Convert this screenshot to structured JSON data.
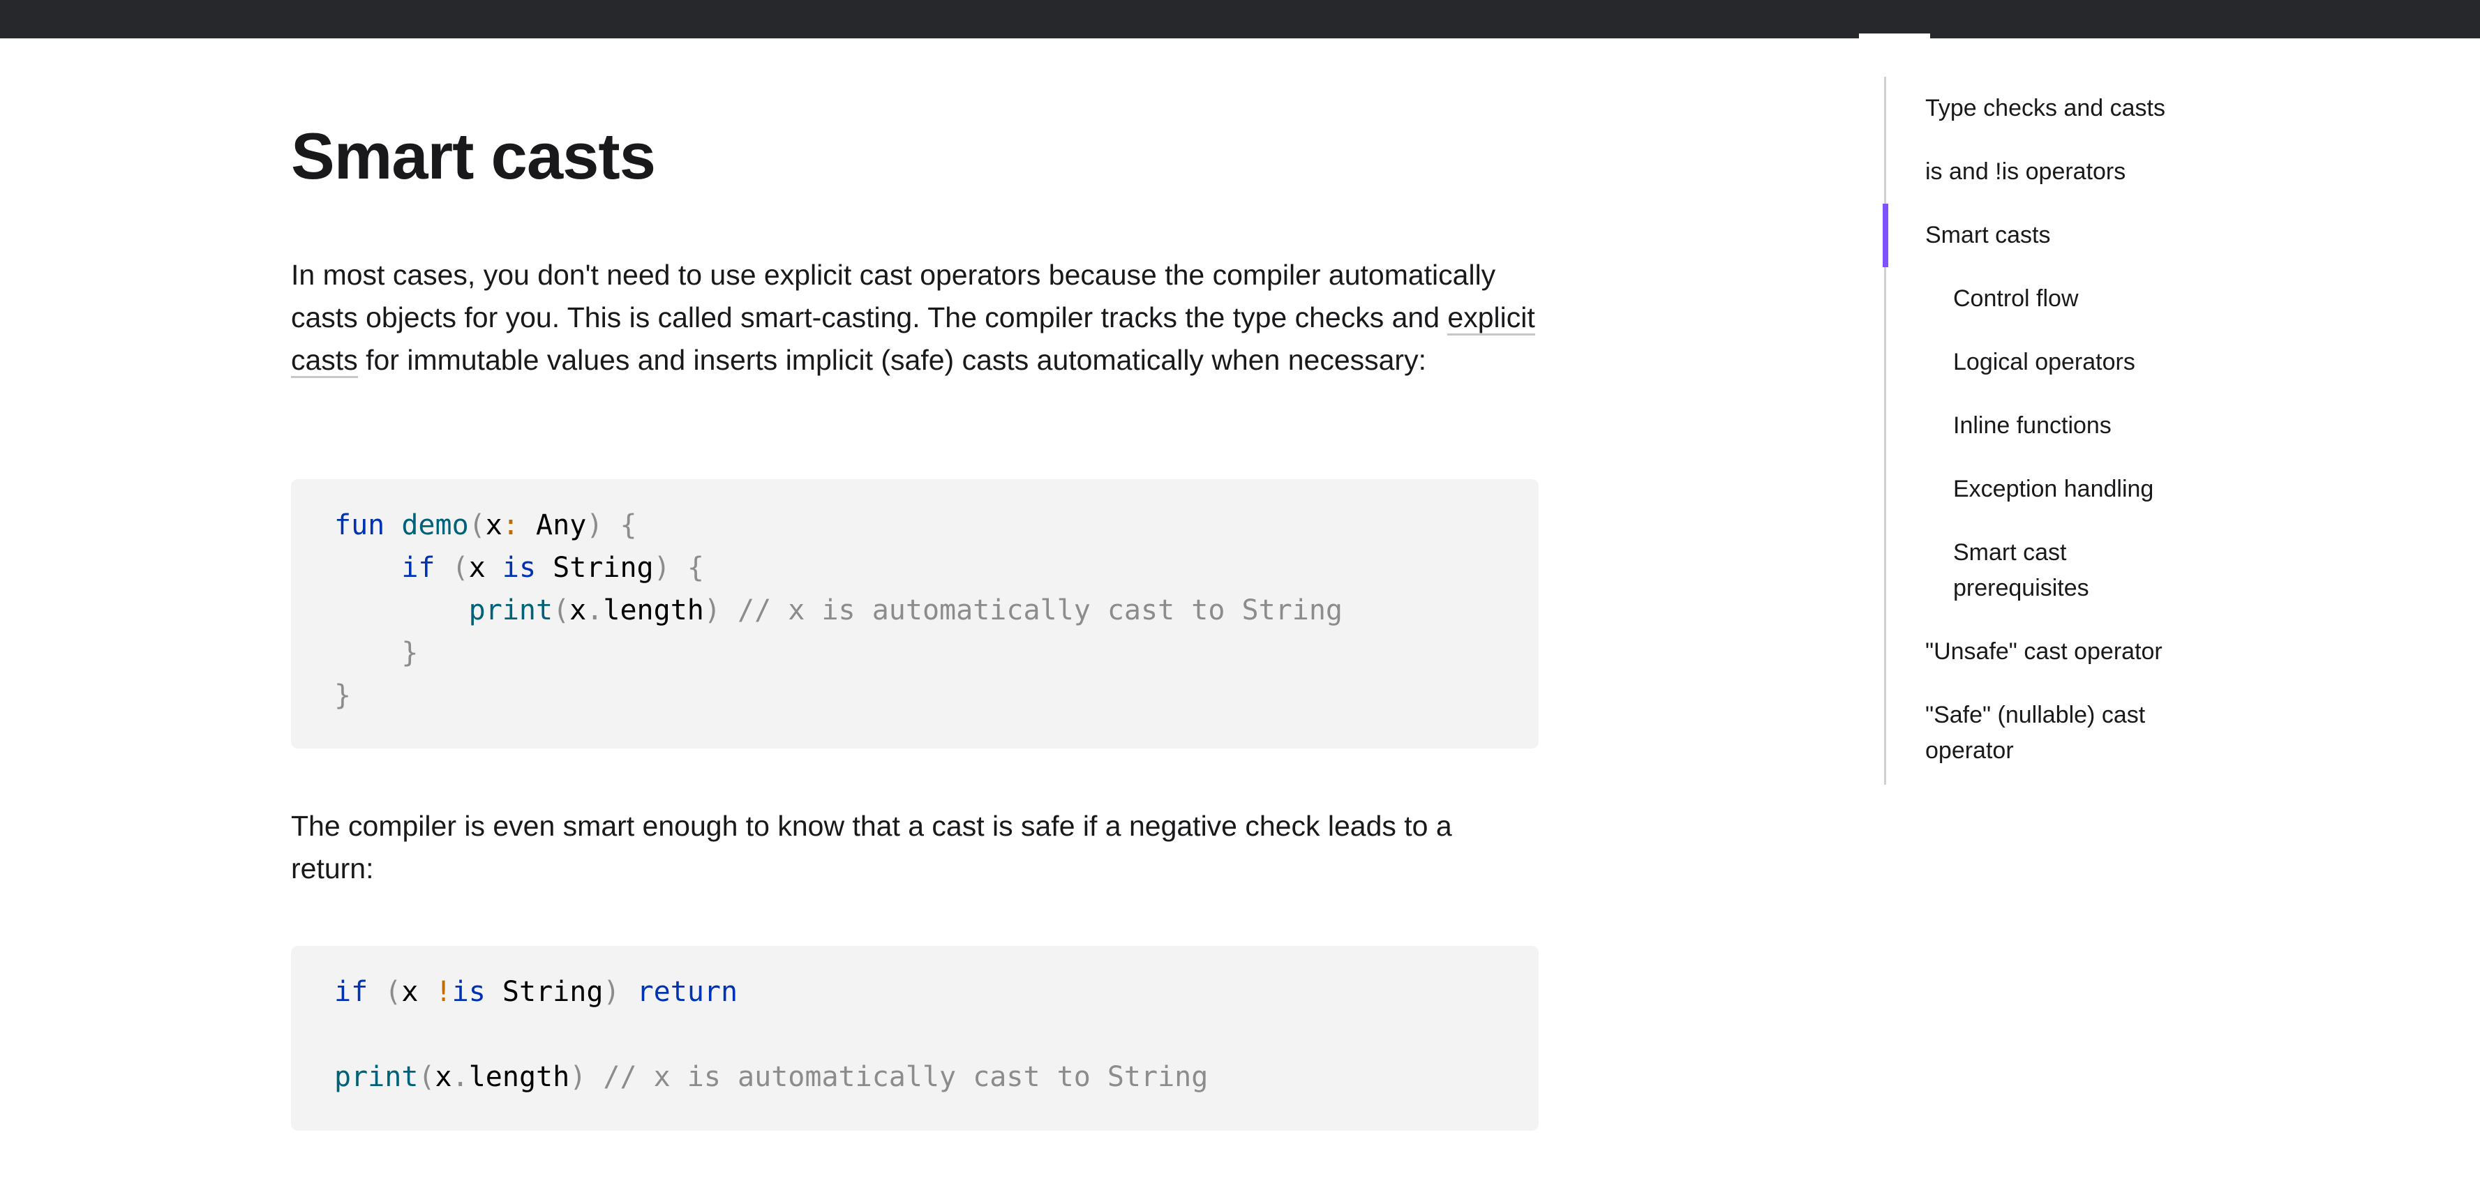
{
  "page": {
    "title": "Smart casts",
    "intro_part1": "In most cases, you don't need to use explicit cast operators because the compiler automatically casts objects for you. This is called smart-casting. The compiler tracks the type checks and ",
    "intro_link": "explicit casts",
    "intro_part2": " for immutable values and inserts implicit (safe) casts automatically when necessary:",
    "para2": "The compiler is even smart enough to know that a cast is safe if a negative check leads to a return:"
  },
  "code1": {
    "fun": "fun",
    "demo": "demo",
    "x": "x",
    "any": "Any",
    "if": "if",
    "is": "is",
    "string": "String",
    "print": "print",
    "length": "length",
    "comment": "// x is automatically cast to String"
  },
  "code2": {
    "if": "if",
    "not": "!",
    "is": "is",
    "string": "String",
    "return": "return",
    "print": "print",
    "x": "x",
    "length": "length",
    "comment": "// x is automatically cast to String"
  },
  "toc": {
    "items": [
      "Type checks and casts",
      "is and !is operators",
      "Smart casts",
      "Control flow",
      "Logical operators",
      "Inline functions",
      "Exception handling",
      "Smart cast prerequisites",
      "\"Unsafe\" cast operator",
      "\"Safe\" (nullable) cast operator"
    ]
  },
  "colors": {
    "accent": "#7f52ff",
    "topbar": "#27282c",
    "keyword": "#0033b3",
    "function": "#00627a",
    "comment": "#8c8c8c"
  }
}
